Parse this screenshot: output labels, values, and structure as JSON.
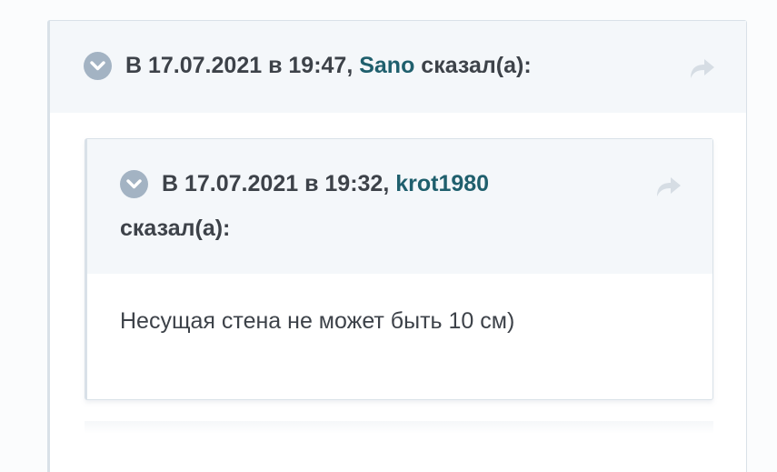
{
  "outer_quote": {
    "prefix": "В 17.07.2021 в 19:47, ",
    "username": "Sano",
    "suffix": " сказал(а):"
  },
  "inner_quote": {
    "prefix": "В 17.07.2021 в 19:32, ",
    "username": "krot1980",
    "suffix_line2": "сказал(а):",
    "body_text": "Несущая стена не может быть 10 см)"
  },
  "icons": {
    "expand": "chevron-down-circle-icon",
    "share": "share-arrow-icon"
  },
  "colors": {
    "username": "#1f5f6d",
    "text": "#3d4249",
    "icon_bg": "#a3b3c3",
    "share_icon": "#d6dde4",
    "header_bg": "#f4f7fa",
    "border": "#d9e1e8"
  }
}
